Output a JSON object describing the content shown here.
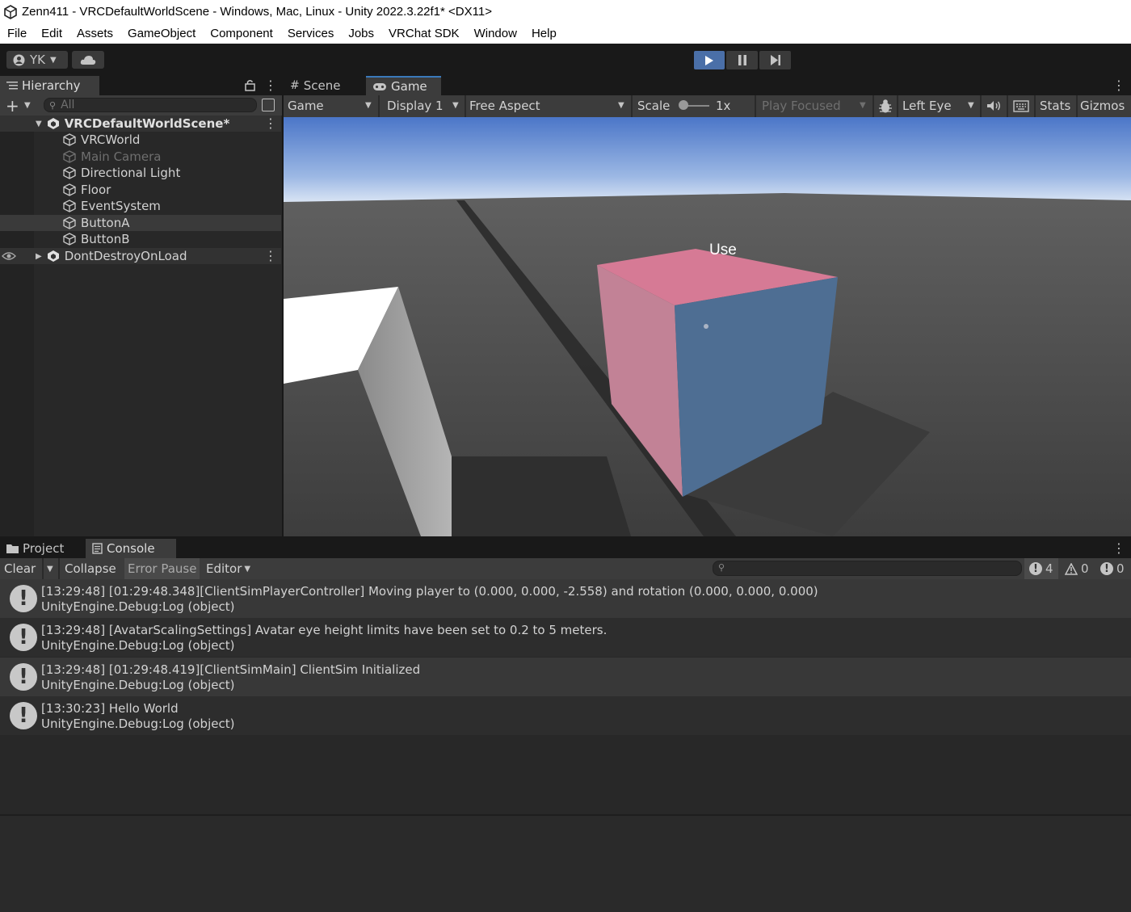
{
  "window": {
    "title": "Zenn411 - VRCDefaultWorldScene - Windows, Mac, Linux - Unity 2022.3.22f1* <DX11>"
  },
  "menu": [
    "File",
    "Edit",
    "Assets",
    "GameObject",
    "Component",
    "Services",
    "Jobs",
    "VRChat SDK",
    "Window",
    "Help"
  ],
  "toolbar": {
    "account_label": "YK",
    "play_state": "playing"
  },
  "hierarchy": {
    "tab_label": "Hierarchy",
    "search_placeholder": "All",
    "scene_name": "VRCDefaultWorldScene*",
    "items": [
      {
        "label": "VRCWorld",
        "disabled": false
      },
      {
        "label": "Main Camera",
        "disabled": true
      },
      {
        "label": "Directional Light",
        "disabled": false
      },
      {
        "label": "Floor",
        "disabled": false
      },
      {
        "label": "EventSystem",
        "disabled": false
      },
      {
        "label": "ButtonA",
        "disabled": false,
        "selected": true
      },
      {
        "label": "ButtonB",
        "disabled": false
      }
    ],
    "ddol_name": "DontDestroyOnLoad"
  },
  "game_view": {
    "tabs": [
      "Scene",
      "Game"
    ],
    "active_tab": "Game",
    "toolbar": {
      "view_mode": "Game",
      "display": "Display 1",
      "aspect": "Free Aspect",
      "scale_label": "Scale",
      "scale_value": "1x",
      "play_focused": "Play Focused",
      "eye": "Left Eye",
      "stats": "Stats",
      "gizmos": "Gizmos"
    },
    "interaction_label": "Use"
  },
  "bottom": {
    "tabs": [
      "Project",
      "Console"
    ],
    "active_tab": "Console",
    "console_toolbar": {
      "clear": "Clear",
      "collapse": "Collapse",
      "error_pause": "Error Pause",
      "editor": "Editor",
      "count_log": "4",
      "count_warn": "0",
      "count_error": "0"
    },
    "logs": [
      {
        "line1": "[13:29:48] [01:29:48.348][ClientSimPlayerController] Moving player to (0.000, 0.000, -2.558) and rotation (0.000, 0.000, 0.000)",
        "line2": "UnityEngine.Debug:Log (object)"
      },
      {
        "line1": "[13:29:48] [AvatarScalingSettings] Avatar eye height limits have been set to 0.2 to 5 meters.",
        "line2": "UnityEngine.Debug:Log (object)"
      },
      {
        "line1": "[13:29:48] [01:29:48.419][ClientSimMain] ClientSim Initialized",
        "line2": "UnityEngine.Debug:Log (object)"
      },
      {
        "line1": "[13:30:23] Hello World",
        "line2": "UnityEngine.Debug:Log (object)"
      }
    ]
  }
}
